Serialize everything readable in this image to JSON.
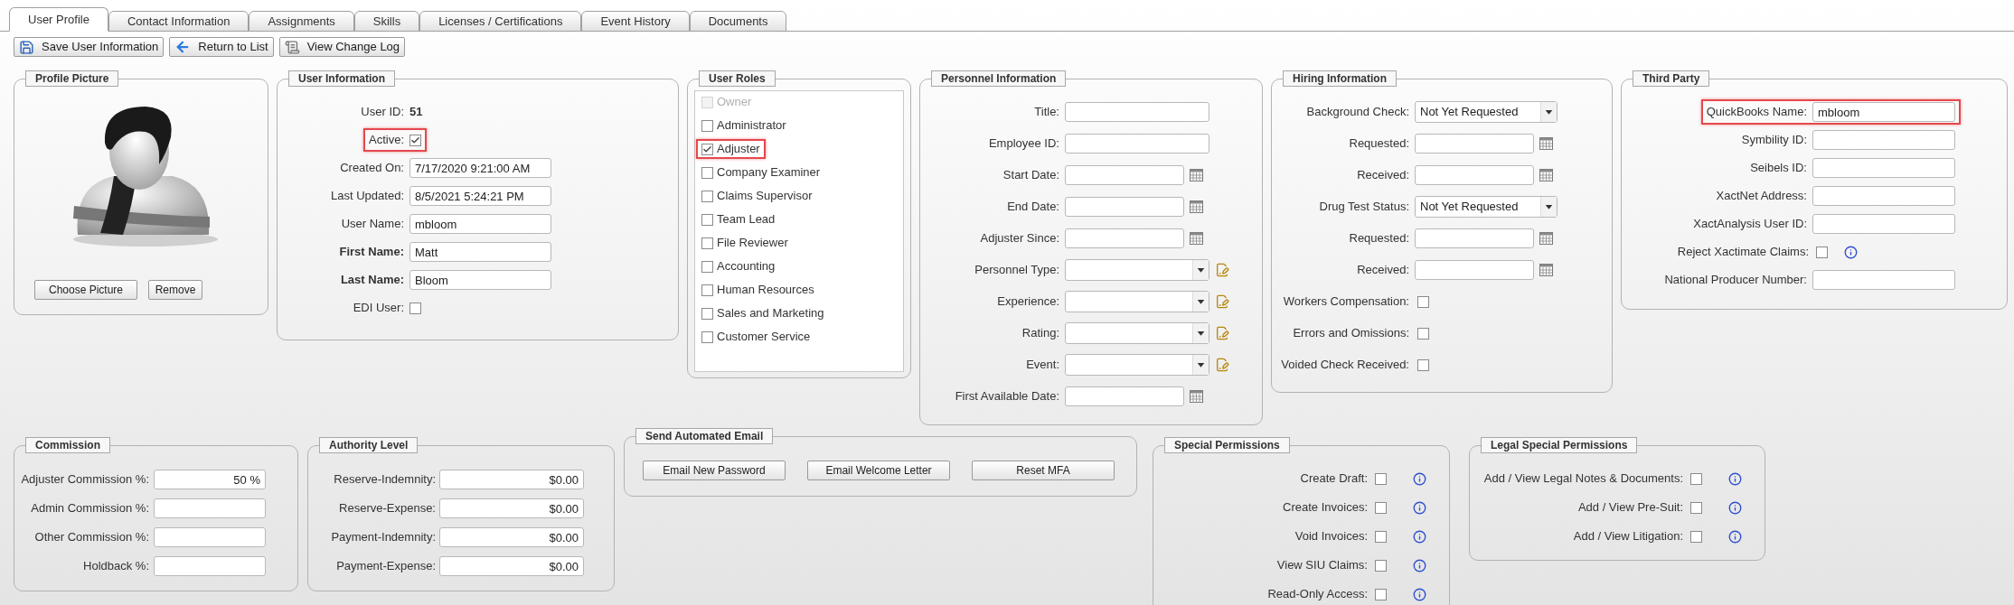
{
  "tabs": [
    {
      "label": "User Profile",
      "selected": true
    },
    {
      "label": "Contact Information",
      "selected": false
    },
    {
      "label": "Assignments",
      "selected": false
    },
    {
      "label": "Skills",
      "selected": false
    },
    {
      "label": "Licenses / Certifications",
      "selected": false
    },
    {
      "label": "Event History",
      "selected": false
    },
    {
      "label": "Documents",
      "selected": false
    }
  ],
  "toolbar": [
    {
      "label": "Save User Information"
    },
    {
      "label": "Return to List"
    },
    {
      "label": "View Change Log"
    }
  ],
  "profile_picture": {
    "title": "Profile Picture",
    "buttons": [
      "Choose Picture",
      "Remove"
    ]
  },
  "user_information": {
    "title": "User Information",
    "fields": [
      {
        "kind": "static",
        "label": "User ID:",
        "value": "51"
      },
      {
        "kind": "check",
        "label": "Active:",
        "checked": true,
        "highlighted": true
      },
      {
        "kind": "text",
        "label": "Created On:",
        "value": "7/17/2020 9:21:00 AM",
        "bold": false
      },
      {
        "kind": "text",
        "label": "Last Updated:",
        "value": "8/5/2021 5:24:21 PM",
        "bold": false
      },
      {
        "kind": "text",
        "label": "User Name:",
        "value": "mbloom",
        "bold": false
      },
      {
        "kind": "text",
        "label": "First Name:",
        "value": "Matt",
        "bold": true
      },
      {
        "kind": "text",
        "label": "Last Name:",
        "value": "Bloom",
        "bold": true
      },
      {
        "kind": "check",
        "label": "EDI User:",
        "checked": false,
        "highlighted": false
      }
    ]
  },
  "user_roles": {
    "title": "User Roles",
    "roles": [
      {
        "label": "Owner",
        "checked": false,
        "disabled": true,
        "highlighted": false
      },
      {
        "label": "Administrator",
        "checked": false,
        "disabled": false,
        "highlighted": false
      },
      {
        "label": "Adjuster",
        "checked": true,
        "disabled": false,
        "highlighted": true
      },
      {
        "label": "Company Examiner",
        "checked": false,
        "disabled": false,
        "highlighted": false
      },
      {
        "label": "Claims Supervisor",
        "checked": false,
        "disabled": false,
        "highlighted": false
      },
      {
        "label": "Team Lead",
        "checked": false,
        "disabled": false,
        "highlighted": false
      },
      {
        "label": "File Reviewer",
        "checked": false,
        "disabled": false,
        "highlighted": false
      },
      {
        "label": "Accounting",
        "checked": false,
        "disabled": false,
        "highlighted": false
      },
      {
        "label": "Human Resources",
        "checked": false,
        "disabled": false,
        "highlighted": false
      },
      {
        "label": "Sales and Marketing",
        "checked": false,
        "disabled": false,
        "highlighted": false
      },
      {
        "label": "Customer Service",
        "checked": false,
        "disabled": false,
        "highlighted": false
      }
    ]
  },
  "personnel_information": {
    "title": "Personnel Information",
    "fields": [
      {
        "kind": "text",
        "label": "Title:"
      },
      {
        "kind": "text",
        "label": "Employee ID:"
      },
      {
        "kind": "date",
        "label": "Start Date:"
      },
      {
        "kind": "date",
        "label": "End Date:"
      },
      {
        "kind": "date",
        "label": "Adjuster Since:"
      },
      {
        "kind": "select",
        "label": "Personnel Type:"
      },
      {
        "kind": "select",
        "label": "Experience:"
      },
      {
        "kind": "select",
        "label": "Rating:"
      },
      {
        "kind": "select",
        "label": "Event:"
      },
      {
        "kind": "date",
        "label": "First Available Date:"
      }
    ]
  },
  "hiring_information": {
    "title": "Hiring Information",
    "fields": [
      {
        "kind": "select",
        "label": "Background Check:",
        "value": "Not Yet Requested"
      },
      {
        "kind": "date",
        "label": "Requested:"
      },
      {
        "kind": "date",
        "label": "Received:"
      },
      {
        "kind": "select",
        "label": "Drug Test Status:",
        "value": "Not Yet Requested"
      },
      {
        "kind": "date",
        "label": "Requested:"
      },
      {
        "kind": "date",
        "label": "Received:"
      },
      {
        "kind": "check",
        "label": "Workers Compensation:",
        "checked": false
      },
      {
        "kind": "check",
        "label": "Errors and Omissions:",
        "checked": false
      },
      {
        "kind": "check",
        "label": "Voided Check Received:",
        "checked": false
      }
    ]
  },
  "third_party": {
    "title": "Third Party",
    "fields": [
      {
        "kind": "text",
        "label": "QuickBooks Name:",
        "value": "mbloom",
        "highlighted": true
      },
      {
        "kind": "text",
        "label": "Symbility ID:",
        "highlighted": false
      },
      {
        "kind": "text",
        "label": "Seibels ID:",
        "highlighted": false
      },
      {
        "kind": "text",
        "label": "XactNet Address:",
        "highlighted": false
      },
      {
        "kind": "text",
        "label": "XactAnalysis User ID:",
        "highlighted": false
      },
      {
        "kind": "check",
        "label": "Reject Xactimate Claims:",
        "checked": false
      },
      {
        "kind": "text",
        "label": "National Producer Number:",
        "highlighted": false
      }
    ]
  },
  "commission": {
    "title": "Commission",
    "fields": [
      {
        "label": "Adjuster Commission %:",
        "value": "50 %"
      },
      {
        "label": "Admin Commission %:"
      },
      {
        "label": "Other Commission %:"
      },
      {
        "label": "Holdback %:"
      }
    ]
  },
  "authority_level": {
    "title": "Authority Level",
    "fields": [
      {
        "label": "Reserve-Indemnity:",
        "value": "$0.00"
      },
      {
        "label": "Reserve-Expense:",
        "value": "$0.00"
      },
      {
        "label": "Payment-Indemnity:",
        "value": "$0.00"
      },
      {
        "label": "Payment-Expense:",
        "value": "$0.00"
      }
    ]
  },
  "send_automated_email": {
    "title": "Send Automated Email",
    "buttons": [
      "Email New Password",
      "Email Welcome Letter",
      "Reset MFA"
    ]
  },
  "special_permissions": {
    "title": "Special Permissions",
    "items": [
      {
        "label": "Create Draft:",
        "checked": false
      },
      {
        "label": "Create Invoices:",
        "checked": false
      },
      {
        "label": "Void Invoices:",
        "checked": false
      },
      {
        "label": "View SIU Claims:",
        "checked": false
      },
      {
        "label": "Read-Only Access:",
        "checked": false
      }
    ]
  },
  "legal_special_permissions": {
    "title": "Legal Special Permissions",
    "items": [
      {
        "label": "Add / View Legal Notes & Documents:",
        "checked": false
      },
      {
        "label": "Add / View Pre-Suit:",
        "checked": false
      },
      {
        "label": "Add / View Litigation:",
        "checked": false
      }
    ]
  }
}
